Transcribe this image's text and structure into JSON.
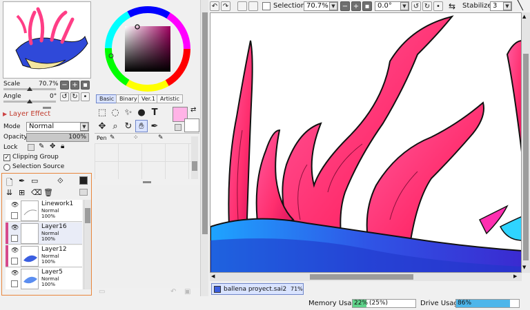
{
  "navigator": {
    "scale_label": "Scale",
    "scale_value": "70.7%",
    "angle_label": "Angle",
    "angle_value": "0°"
  },
  "layer_effect": {
    "title": "Layer Effect",
    "mode_label": "Mode",
    "mode_value": "Normal",
    "opacity_label": "Opacity",
    "opacity_value": "100%",
    "lock_label": "Lock",
    "clipping_group": "Clipping Group",
    "selection_source": "Selection Source"
  },
  "layers": [
    {
      "name": "Linework1",
      "mode": "Normal",
      "opacity": "100%"
    },
    {
      "name": "Layer16",
      "mode": "Normal",
      "opacity": "100%"
    },
    {
      "name": "Layer12",
      "mode": "Normal",
      "opacity": "100%"
    },
    {
      "name": "Layer5",
      "mode": "Normal",
      "opacity": "100%"
    }
  ],
  "color_tabs": [
    "Basic",
    "Binary",
    "Ver.1",
    "Artistic"
  ],
  "brush_list": {
    "item1": "Pen"
  },
  "toolbar": {
    "selection_label": "Selection",
    "zoom_value": "70.7%",
    "angle_value": "0.0°",
    "stabilizer_label": "Stabilizer",
    "stabilizer_value": "3"
  },
  "document_tab": {
    "name": "ballena proyect.sai2",
    "zoom": "71%"
  },
  "status": {
    "memory_label": "Memory Usage",
    "memory_value": "22%",
    "memory_extra": "(25%)",
    "drive_label": "Drive Usage",
    "drive_value": "86%",
    "memory_fraction": 0.22,
    "drive_fraction": 0.86
  },
  "colors": {
    "current_color": "#ffb3e6",
    "secondary_color": "#ffffff",
    "accent_orange": "#e8853a",
    "memory_bar": "#5fd38a",
    "drive_bar": "#4db6ea"
  }
}
